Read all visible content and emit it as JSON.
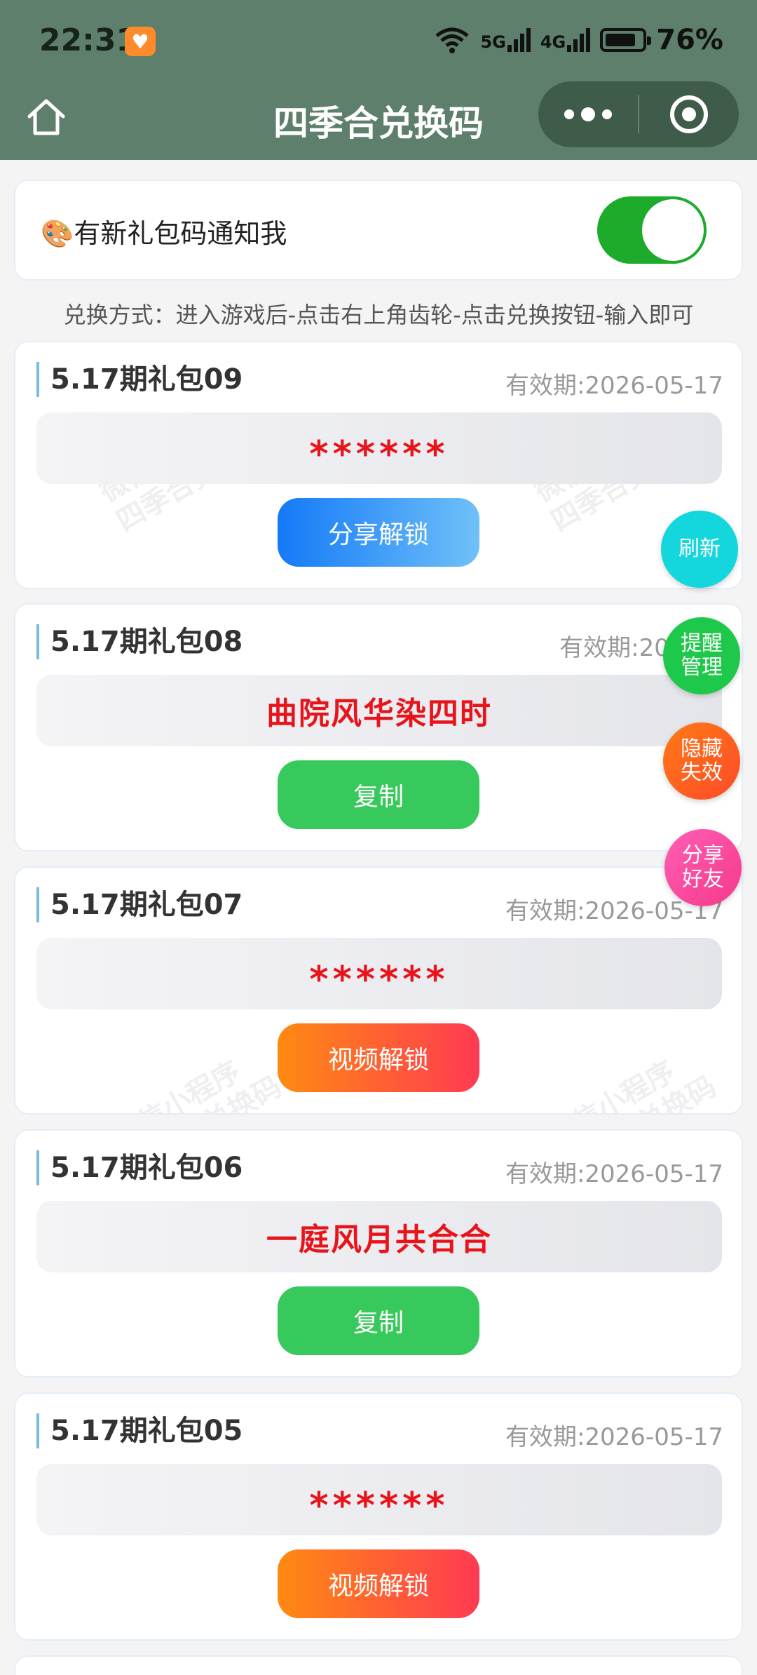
{
  "status": {
    "time": "22:31",
    "net1": "5G",
    "net2": "4G",
    "battery": "76%"
  },
  "nav": {
    "title": "四季合兑换码"
  },
  "notify": {
    "label": "🎨有新礼包码通知我",
    "enabled": true
  },
  "howto": "兑换方式：进入游戏后-点击右上角齿轮-点击兑换按钮-输入即可",
  "watermark": "微信小程序\n四季合兑换码",
  "cards": [
    {
      "title": "5.17期礼包09",
      "date": "有效期:2026-05-17",
      "code": "******",
      "hidden": true,
      "button": "分享解锁",
      "btn_type": "share"
    },
    {
      "title": "5.17期礼包08",
      "date": "有效期:2026-0",
      "code": "曲院风华染四时",
      "hidden": false,
      "button": "复制",
      "btn_type": "copy"
    },
    {
      "title": "5.17期礼包07",
      "date": "有效期:2026-05-17",
      "code": "******",
      "hidden": true,
      "button": "视频解锁",
      "btn_type": "video"
    },
    {
      "title": "5.17期礼包06",
      "date": "有效期:2026-05-17",
      "code": "一庭风月共合合",
      "hidden": false,
      "button": "复制",
      "btn_type": "copy"
    },
    {
      "title": "5.17期礼包05",
      "date": "有效期:2026-05-17",
      "code": "******",
      "hidden": true,
      "button": "视频解锁",
      "btn_type": "video"
    }
  ],
  "fabs": {
    "refresh": "刷新",
    "remind": "提醒\n管理",
    "hide": "隐藏\n失效",
    "share": "分享\n好友"
  }
}
